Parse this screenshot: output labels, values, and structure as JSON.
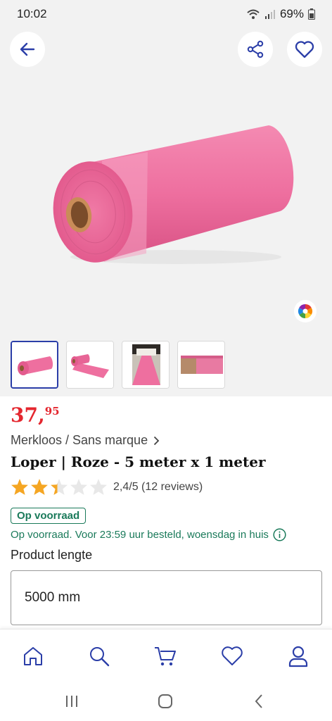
{
  "status_bar": {
    "time": "10:02",
    "battery": "69%"
  },
  "header": {
    "back_icon": "arrow-left-icon",
    "share_icon": "share-icon",
    "favorite_icon": "heart-icon",
    "color_icon": "color-wheel-icon"
  },
  "gallery": {
    "thumbnails": [
      "thumb-roll-small",
      "thumb-roll-unrolled",
      "thumb-runner-event",
      "thumb-runner-closeup"
    ],
    "active_index": 0
  },
  "product": {
    "price_main": "37,",
    "price_decimals": "95",
    "brand": "Merkloos / Sans marque",
    "title": "Loper | Roze - 5 meter x 1 meter",
    "rating_value": 2.4,
    "rating_max": 5,
    "rating_text": "2,4/5 (12 reviews)",
    "stock_badge": "Op voorraad",
    "delivery": "Op voorraad. Voor 23:59 uur besteld, woensdag in huis"
  },
  "options": {
    "label": "Product lengte",
    "selected": "5000 mm"
  },
  "bottom_nav": [
    "home-icon",
    "search-icon",
    "cart-icon",
    "heart-icon",
    "account-icon"
  ],
  "colors": {
    "accent": "#2b3ea8",
    "price": "#e4262e",
    "stock": "#1a7a5a",
    "star": "#f5a623",
    "product_pink": "#ee6f9f"
  }
}
